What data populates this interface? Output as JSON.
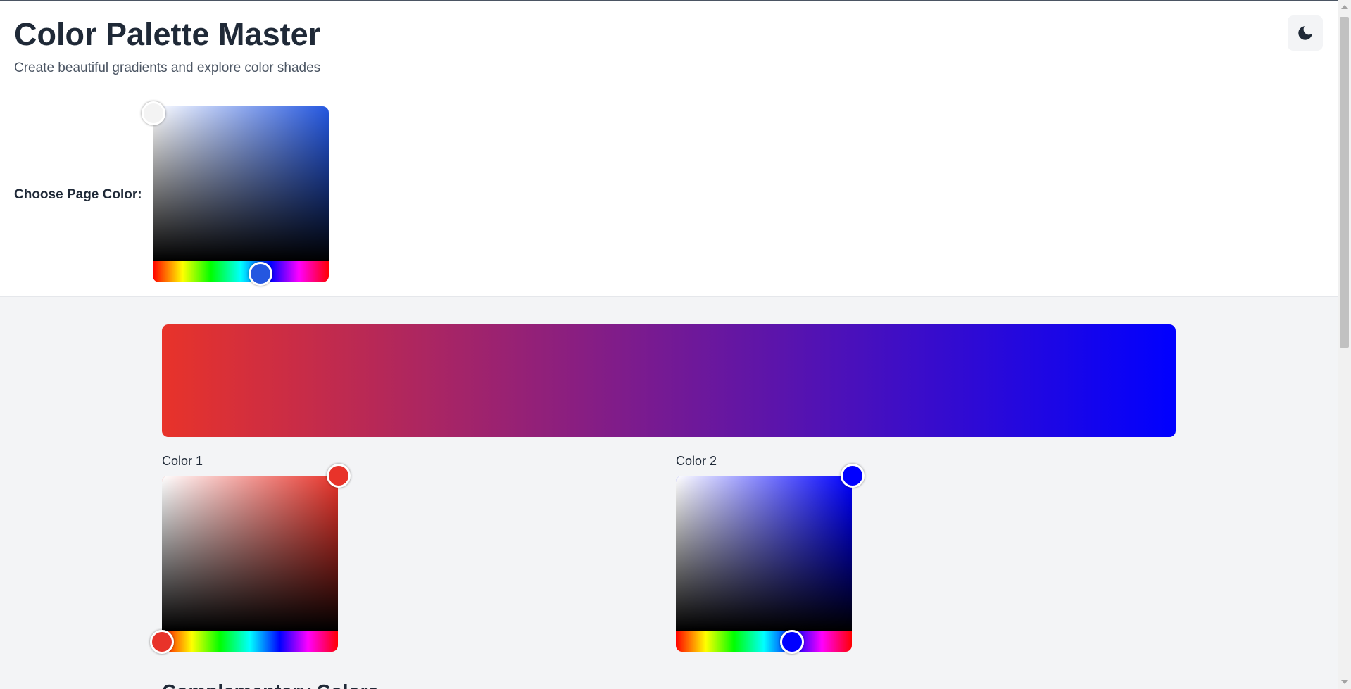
{
  "app": {
    "title": "Color Palette Master",
    "subtitle": "Create beautiful gradients and explore color shades",
    "theme_toggle_icon": "moon-icon"
  },
  "page_color": {
    "label": "Choose Page Color:",
    "value": "#2457e0",
    "hue_color": "#2457e0",
    "saturation_knob_color": "#f3f3f3",
    "hue_position": 0.61
  },
  "gradient": {
    "start": "#e8332a",
    "end": "#0000ff"
  },
  "color1": {
    "label": "Color 1",
    "value": "#e8332a",
    "hue_color": "#e8332a",
    "hue_position": 0.0
  },
  "color2": {
    "label": "Color 2",
    "value": "#0000ff",
    "hue_color": "#0000ff",
    "hue_position": 0.66
  },
  "next_section": {
    "title": "Complementary Colors"
  },
  "colors": {
    "background": "#f3f4f6",
    "header_background": "#ffffff",
    "text": "#1f2937",
    "muted_text": "#4b5563"
  }
}
